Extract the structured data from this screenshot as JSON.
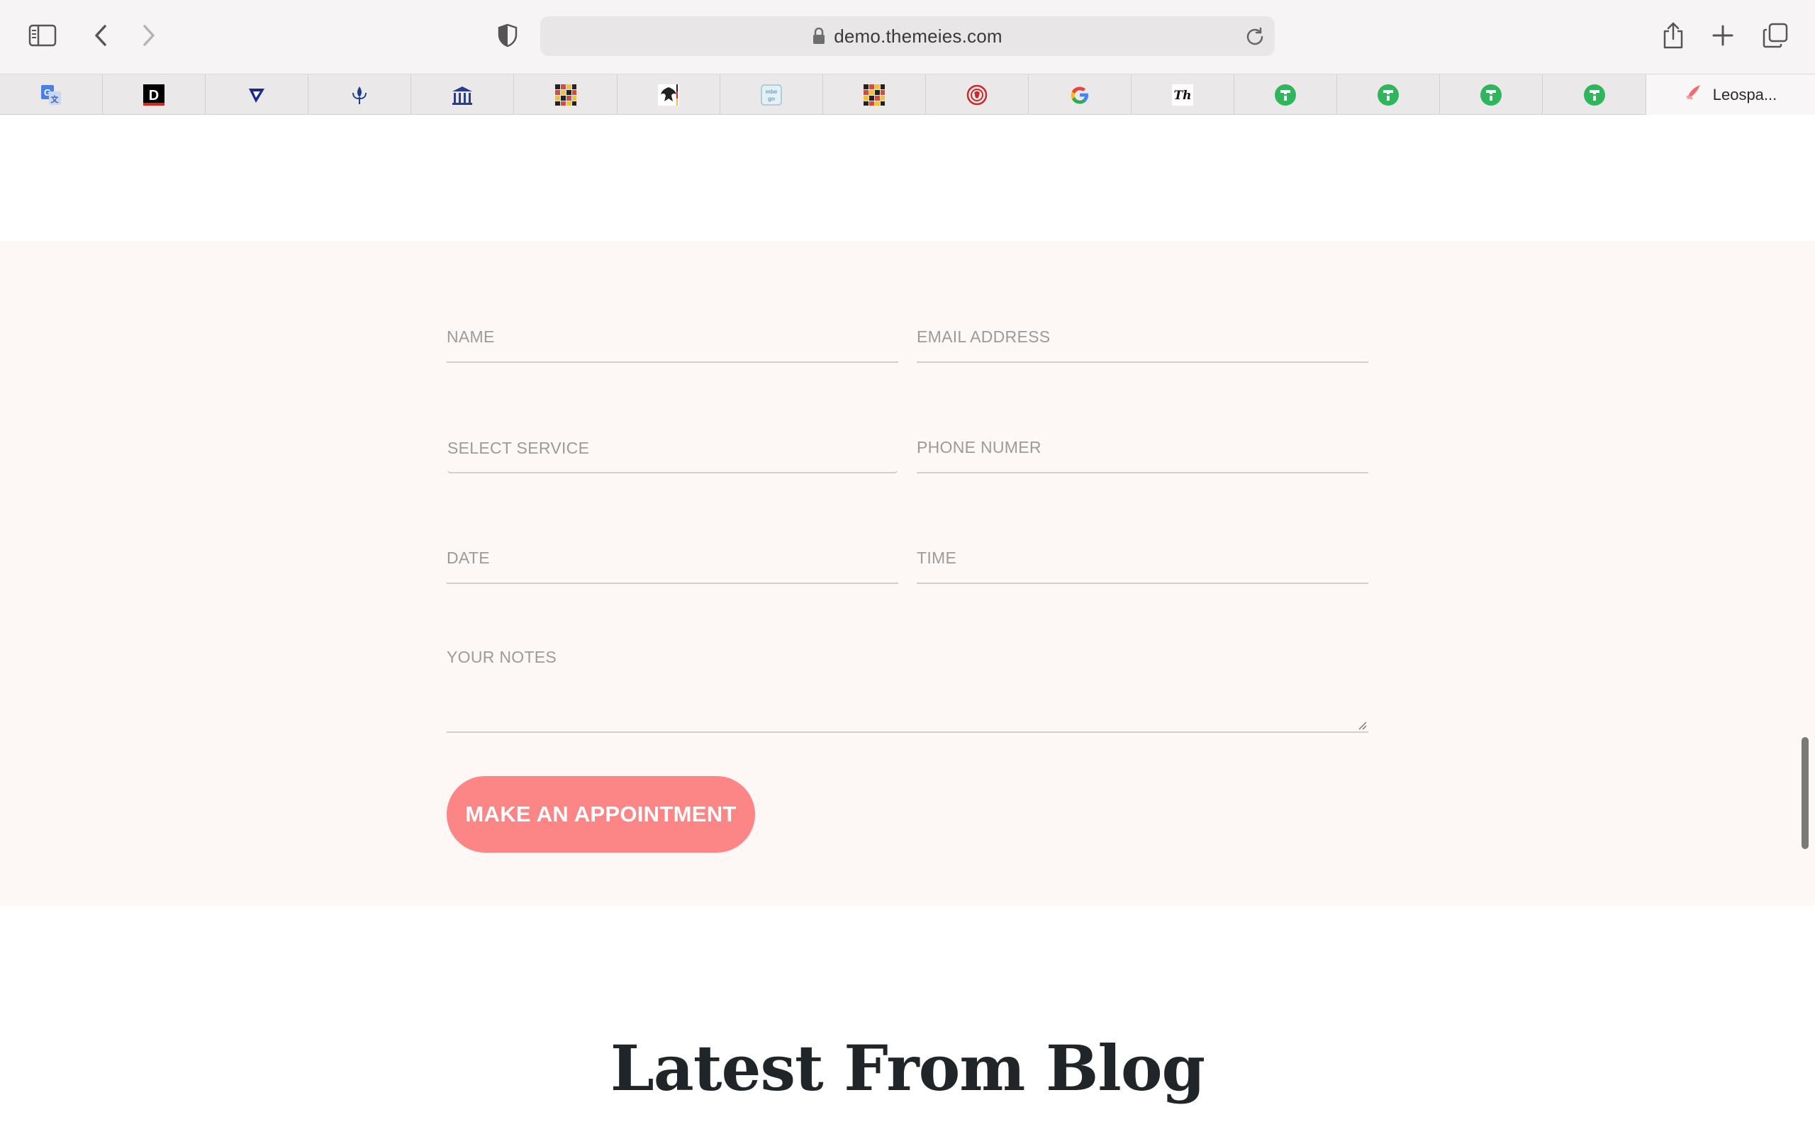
{
  "browser": {
    "url": "demo.themeies.com",
    "active_tab_label": "Leospa...",
    "favorites": [
      {
        "icon": "google-translate-icon",
        "color": "#4a7fe6"
      },
      {
        "icon": "d-logo-icon",
        "color": "#000000"
      },
      {
        "icon": "v-check-icon",
        "color": "#1a2a8c"
      },
      {
        "icon": "fleur-icon",
        "color": "#1f3f8a"
      },
      {
        "icon": "building-icon",
        "color": "#2a3d8f"
      },
      {
        "icon": "grid-colorful-icon",
        "color": "#d84a3a"
      },
      {
        "icon": "eagle-crest-icon",
        "color": "#222222"
      },
      {
        "icon": "map-tile-icon",
        "color": "#9ac4d8"
      },
      {
        "icon": "grid-colorful-icon",
        "color": "#d84a3a"
      },
      {
        "icon": "red-seal-icon",
        "color": "#cc2a2a"
      },
      {
        "icon": "google-icon",
        "color": "#4285f4"
      },
      {
        "icon": "italic-th-icon",
        "color": "#111111"
      },
      {
        "icon": "green-t-icon",
        "color": "#2fb65c"
      },
      {
        "icon": "green-t-icon",
        "color": "#2fb65c"
      },
      {
        "icon": "green-t-icon",
        "color": "#2fb65c"
      },
      {
        "icon": "green-t-icon",
        "color": "#2fb65c"
      }
    ]
  },
  "form": {
    "name_placeholder": "NAME",
    "email_placeholder": "EMAIL ADDRESS",
    "service_placeholder": "SELECT SERVICE",
    "phone_placeholder": "PHONE NUMER",
    "date_placeholder": "DATE",
    "time_placeholder": "TIME",
    "notes_placeholder": "YOUR NOTES",
    "submit_label": "MAKE AN APPOINTMENT"
  },
  "blog": {
    "title": "Latest From Blog"
  },
  "colors": {
    "accent": "#fc8686",
    "section_bg": "#fdf7f5",
    "heading": "#1f2528"
  }
}
